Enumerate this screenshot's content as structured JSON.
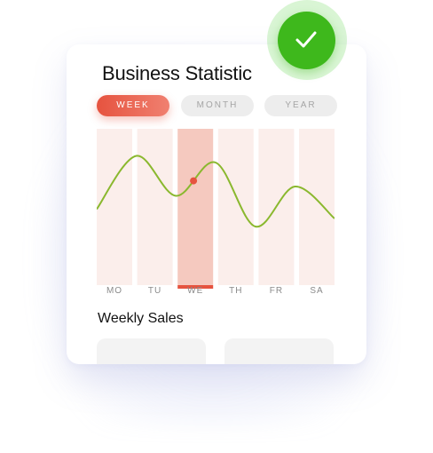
{
  "card": {
    "title": "Business Statistic",
    "subtitle": "Weekly Sales"
  },
  "tabs": [
    {
      "label": "WEEK",
      "selected": true
    },
    {
      "label": "MONTH",
      "selected": false
    },
    {
      "label": "YEAR",
      "selected": false
    }
  ],
  "chart_data": {
    "type": "line",
    "categories": [
      "MO",
      "TU",
      "WE",
      "TH",
      "FR",
      "SA"
    ],
    "highlighted_category": "WE",
    "values": [
      0.45,
      0.85,
      0.55,
      0.8,
      0.32,
      0.62,
      0.38
    ],
    "line_color": "#8ab82e",
    "marker_color": "#e6533f",
    "bar_color": "#fbeeeb",
    "highlight_bar_color": "#f5c9bf"
  },
  "colors": {
    "accent": "#e6533f",
    "success": "#3eb81c"
  },
  "badge": {
    "icon": "check-icon"
  }
}
